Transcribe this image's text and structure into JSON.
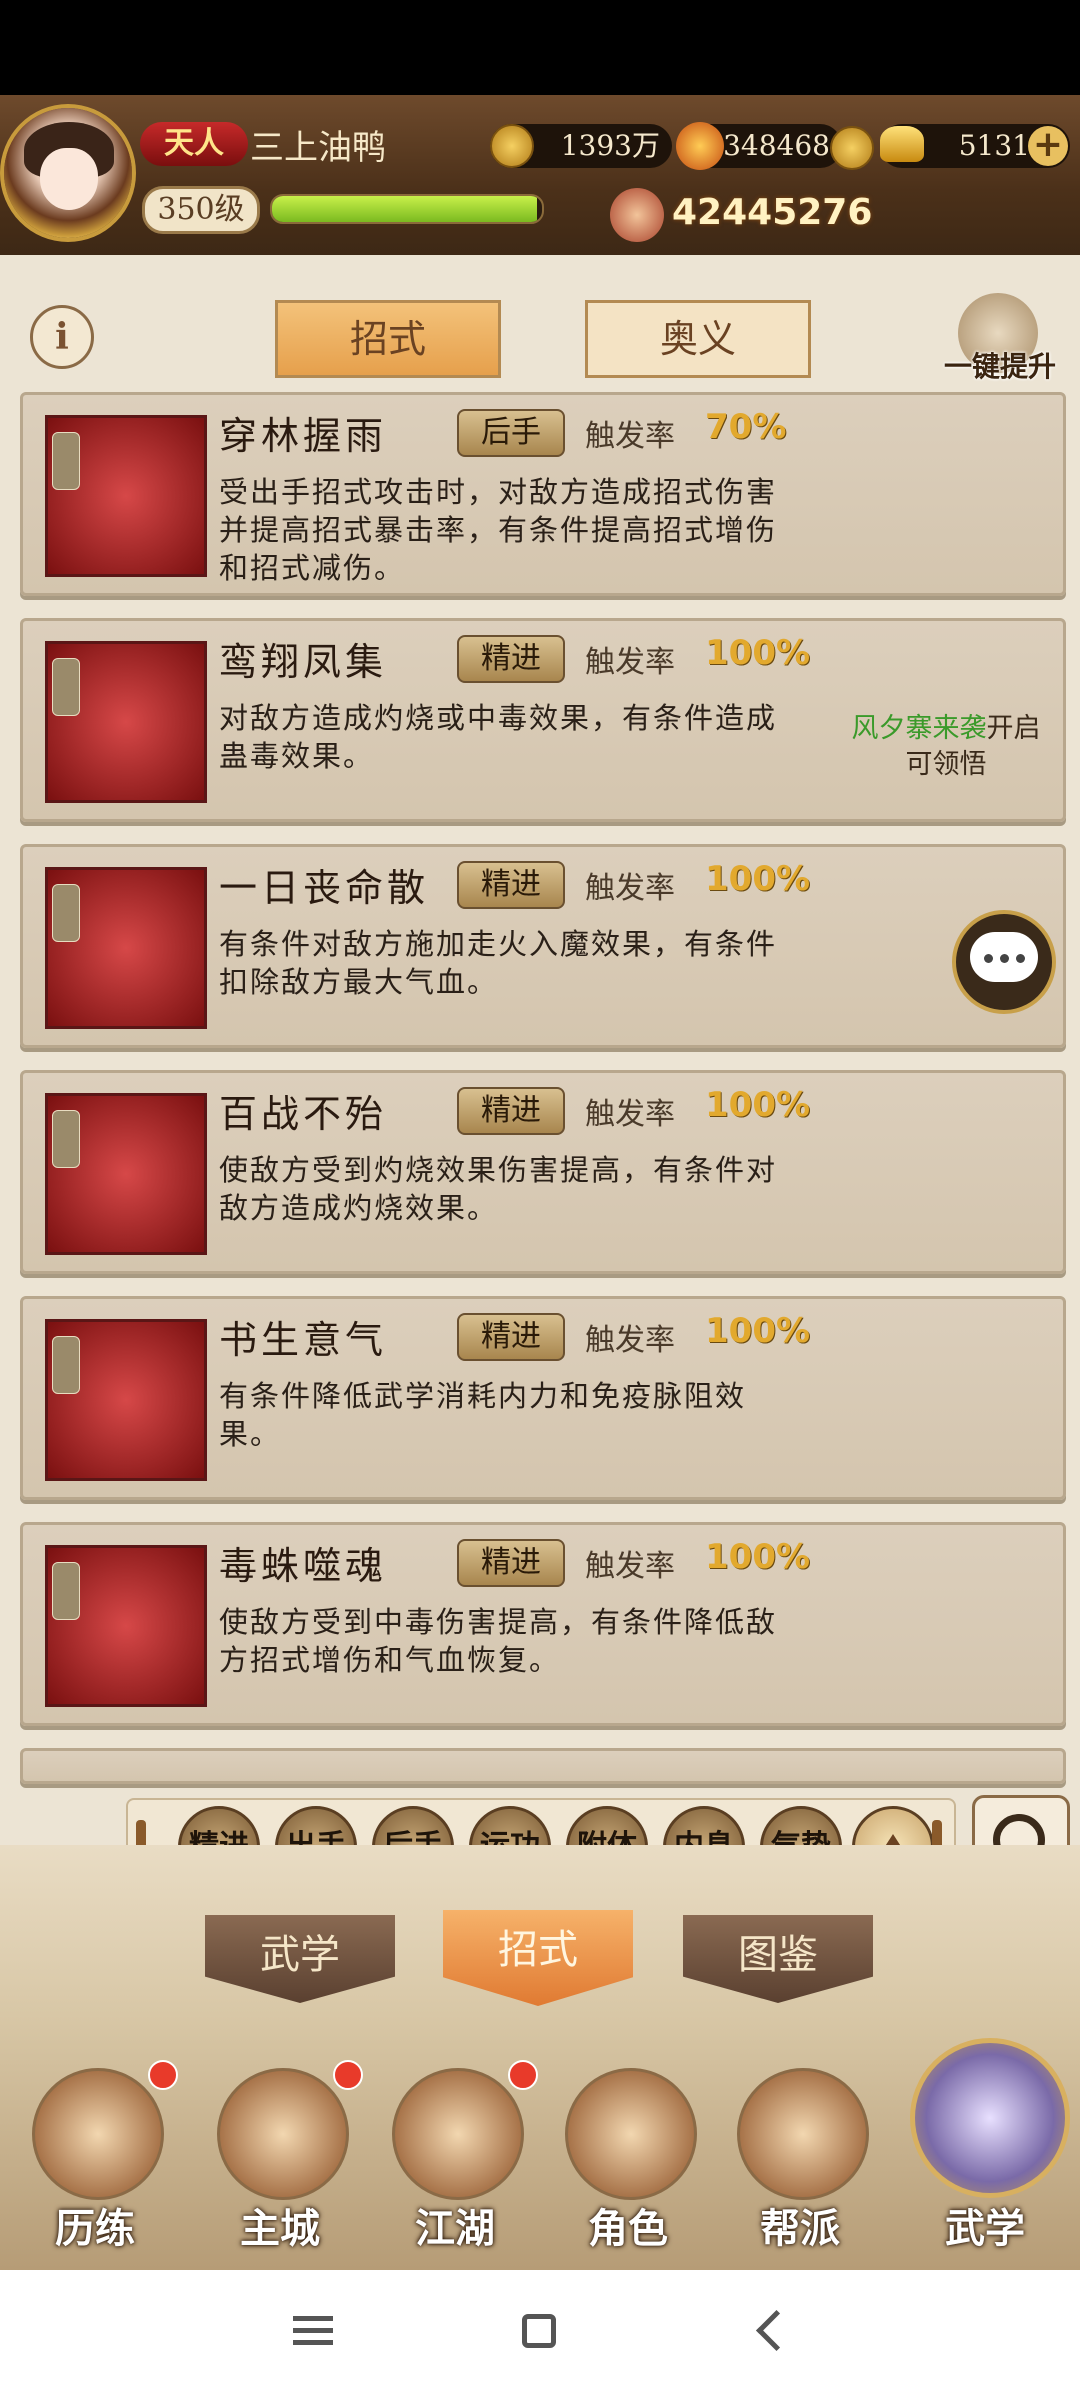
{
  "header": {
    "rank": "天人",
    "player_name": "三上油鸭",
    "level": "350级",
    "xp_fraction": 0.98,
    "coins": "1393万",
    "flame_points": "348468",
    "ingots": "5131",
    "power": "42445276"
  },
  "top_tabs": {
    "moves": "招式",
    "mystery": "奥义"
  },
  "oneclick_label": "一键提升",
  "cards": [
    {
      "title": "穿林握雨",
      "badge": "后手",
      "rate_label": "触发率",
      "rate": "70%",
      "desc": "受出手招式攻击时，对敌方造成招式伤害并提高招式暴击率，有条件提高招式增伤和招式减伤。"
    },
    {
      "title": "鸾翔凤集",
      "badge": "精进",
      "rate_label": "触发率",
      "rate": "100%",
      "desc": "对敌方造成灼烧或中毒效果，有条件造成蛊毒效果。",
      "unlock_event": "风夕寨来袭",
      "unlock_suffix": "开启",
      "unlock_line2": "可领悟"
    },
    {
      "title": "一日丧命散",
      "badge": "精进",
      "rate_label": "触发率",
      "rate": "100%",
      "desc": "有条件对敌方施加走火入魔效果，有条件扣除敌方最大气血。"
    },
    {
      "title": "百战不殆",
      "badge": "精进",
      "rate_label": "触发率",
      "rate": "100%",
      "desc": "使敌方受到灼烧效果伤害提高，有条件对敌方造成灼烧效果。"
    },
    {
      "title": "书生意气",
      "badge": "精进",
      "rate_label": "触发率",
      "rate": "100%",
      "desc": "有条件降低武学消耗内力和免疫脉阻效果。"
    },
    {
      "title": "毒蛛噬魂",
      "badge": "精进",
      "rate_label": "触发率",
      "rate": "100%",
      "desc": "使敌方受到中毒伤害提高，有条件降低敌方招式增伤和气血恢复。"
    }
  ],
  "filters": [
    "精进",
    "出手",
    "后手",
    "运功",
    "附体",
    "内息",
    "气势"
  ],
  "sub_tabs": [
    "武学",
    "招式",
    "图鉴"
  ],
  "nav": [
    {
      "label": "历练",
      "dot": true
    },
    {
      "label": "主城",
      "dot": true
    },
    {
      "label": "江湖",
      "dot": true
    },
    {
      "label": "角色",
      "dot": false
    },
    {
      "label": "帮派",
      "dot": false
    },
    {
      "label": "武学",
      "dot": false
    }
  ]
}
